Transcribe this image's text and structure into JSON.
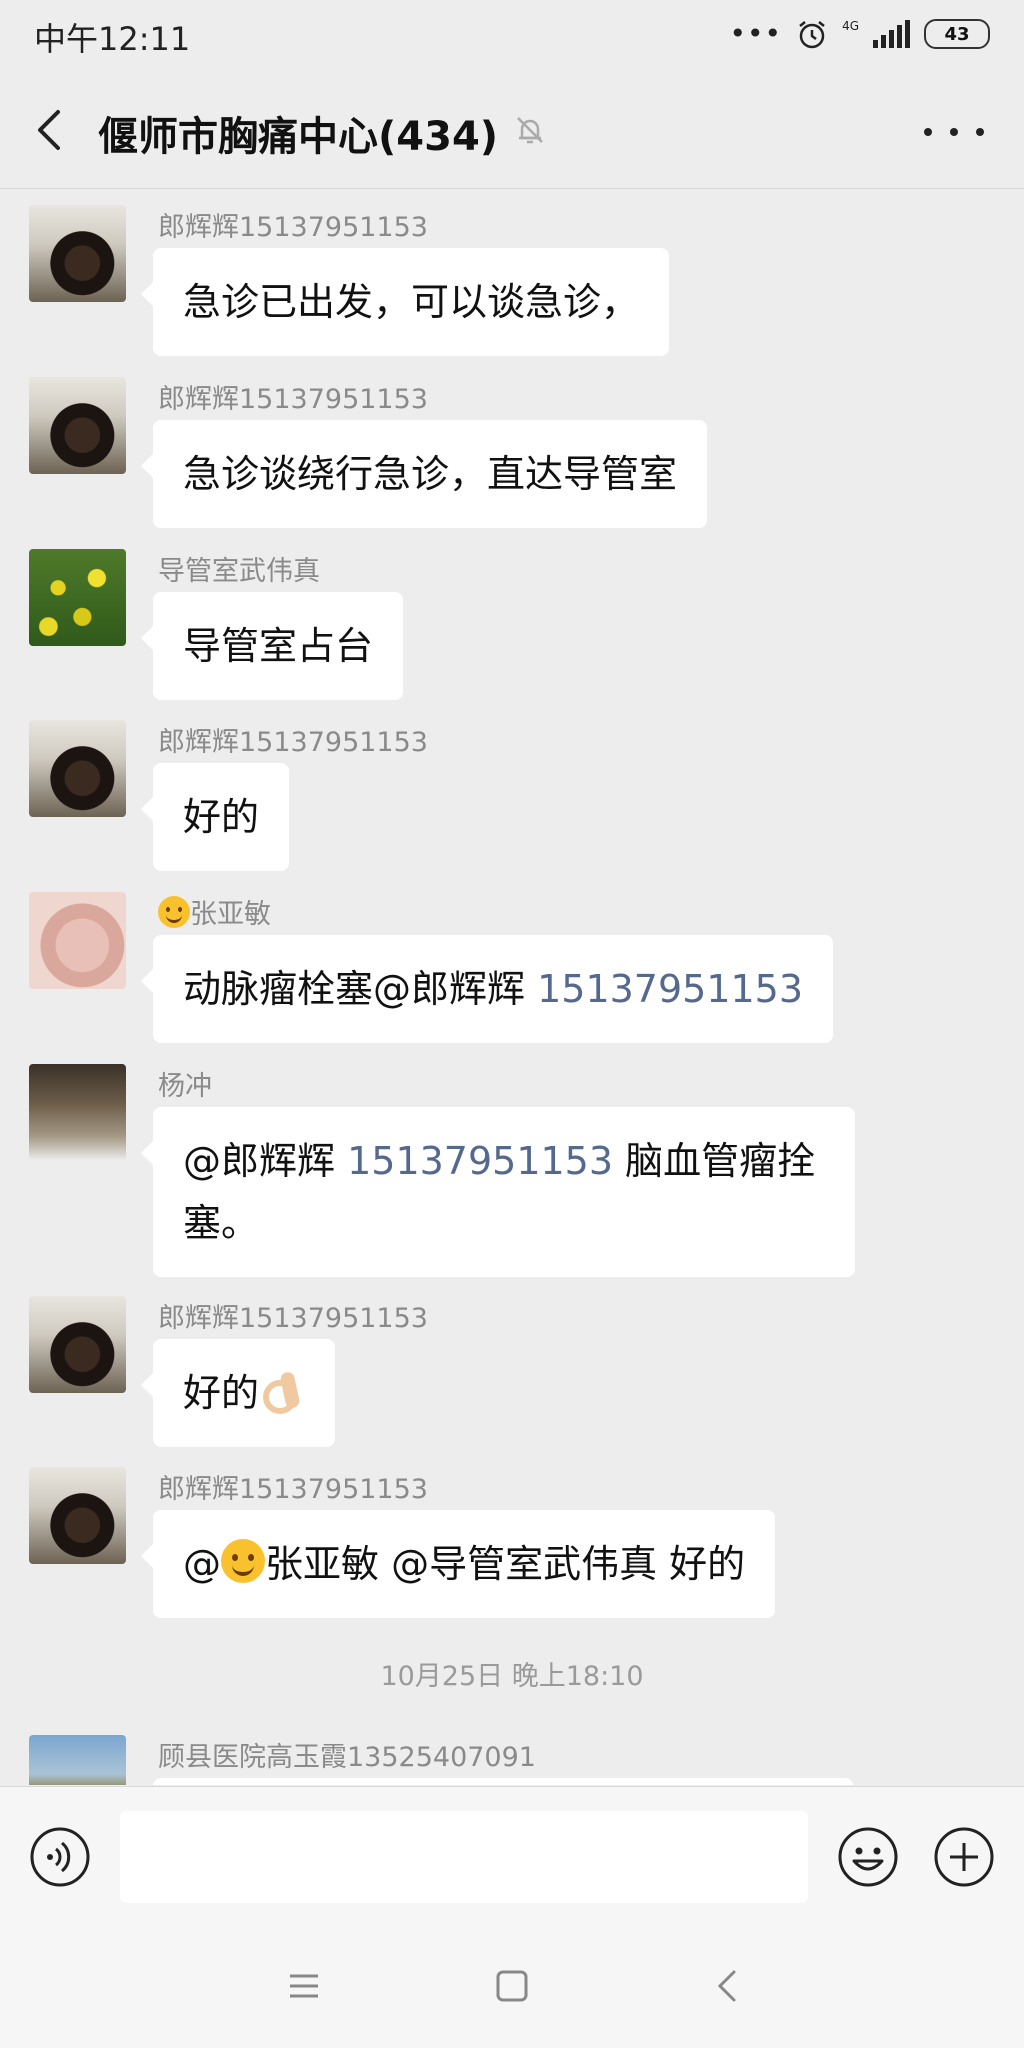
{
  "status_bar": {
    "time": "中午12:11",
    "network": "4G",
    "battery": "43"
  },
  "header": {
    "title": "偃师市胸痛中心(434)"
  },
  "messages": [
    {
      "sender": "郎辉辉15137951153",
      "text": "急诊已出发，可以谈急诊，"
    },
    {
      "sender": "郎辉辉15137951153",
      "text": "急诊谈绕行急诊，直达导管室"
    },
    {
      "sender": "导管室武伟真",
      "text": "导管室占台"
    },
    {
      "sender": "郎辉辉15137951153",
      "text": "好的"
    },
    {
      "sender": "张亚敏",
      "text_prefix": "动脉瘤栓塞@郎辉辉 ",
      "link": "15137951153"
    },
    {
      "sender": "杨冲",
      "text_prefix": "@郎辉辉 ",
      "link": "15137951153",
      "text_suffix": " 脑血管瘤拴塞。"
    },
    {
      "sender": "郎辉辉15137951153",
      "text": "好的"
    },
    {
      "sender": "郎辉辉15137951153",
      "text_prefix": "@",
      "text_mid": "张亚敏 @导管室武伟真  好的"
    }
  ],
  "divider": "10月25日 晚上18:10",
  "last_sender": "顾县医院高玉霞13525407091",
  "input": {
    "placeholder": ""
  },
  "colors": {
    "background": "#ededed",
    "bubble": "#ffffff",
    "link": "#54698d"
  },
  "icons": [
    "back-arrow-icon",
    "mute-bell-icon",
    "more-icon",
    "voice-icon",
    "emoji-icon",
    "plus-icon",
    "menu-icon",
    "home-icon",
    "nav-back-icon"
  ]
}
